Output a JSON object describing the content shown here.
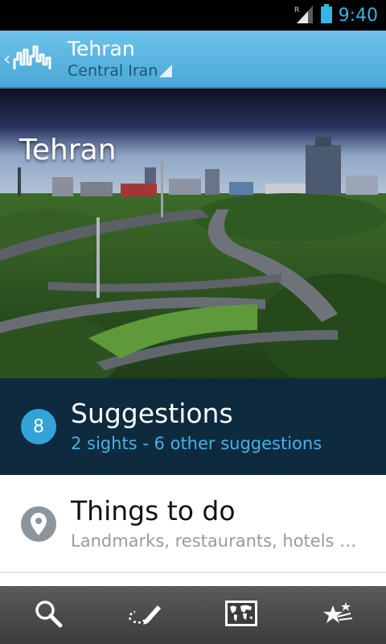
{
  "status_bar": {
    "time": "9:40",
    "roaming_indicator": "R"
  },
  "action_bar": {
    "title": "Tehran",
    "subtitle": "Central Iran",
    "app_icon": "city-skyline-icon"
  },
  "hero": {
    "title": "Tehran"
  },
  "suggestions": {
    "count": "8",
    "title": "Suggestions",
    "subtitle": "2 sights - 6 other suggestions"
  },
  "things_to_do": {
    "title": "Things to do",
    "subtitle": "Landmarks, restaurants, hotels …"
  },
  "bottom_nav": {
    "items": [
      {
        "icon": "search-icon"
      },
      {
        "icon": "itinerary-pencil-icon"
      },
      {
        "icon": "world-map-icon"
      },
      {
        "icon": "favorite-stars-icon"
      }
    ]
  },
  "colors": {
    "action_bar": "#55b0de",
    "accent": "#33b5e5",
    "suggestions_bg": "#0e2a3f",
    "badge": "#33a3d8",
    "pin_circle": "#8d959c",
    "bottom_bar": "#4a4a4a"
  }
}
